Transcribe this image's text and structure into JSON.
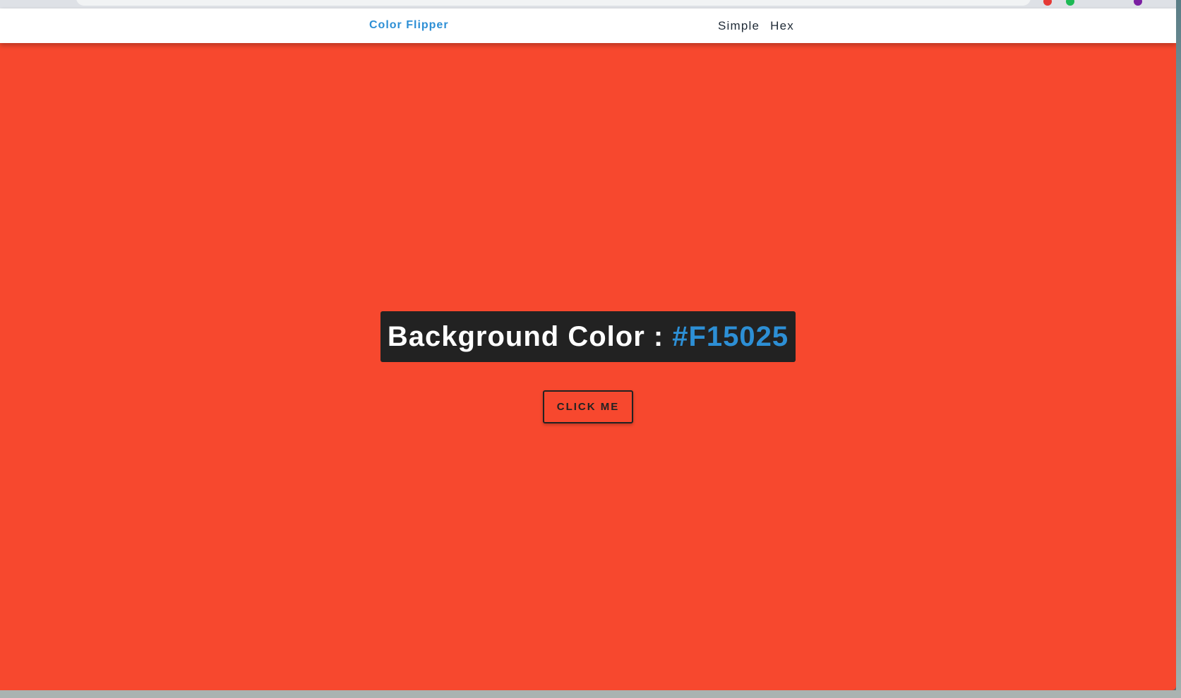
{
  "colors": {
    "background": "#F7482E",
    "brand": "#2D8FD5",
    "hex_text": "#2D8FD5"
  },
  "nav": {
    "brand": "Color Flipper",
    "links": [
      {
        "label": "Simple"
      },
      {
        "label": "Hex"
      }
    ]
  },
  "main": {
    "label": "Background Color :",
    "color_value": "#F15025",
    "button_label": "CLICK ME"
  }
}
